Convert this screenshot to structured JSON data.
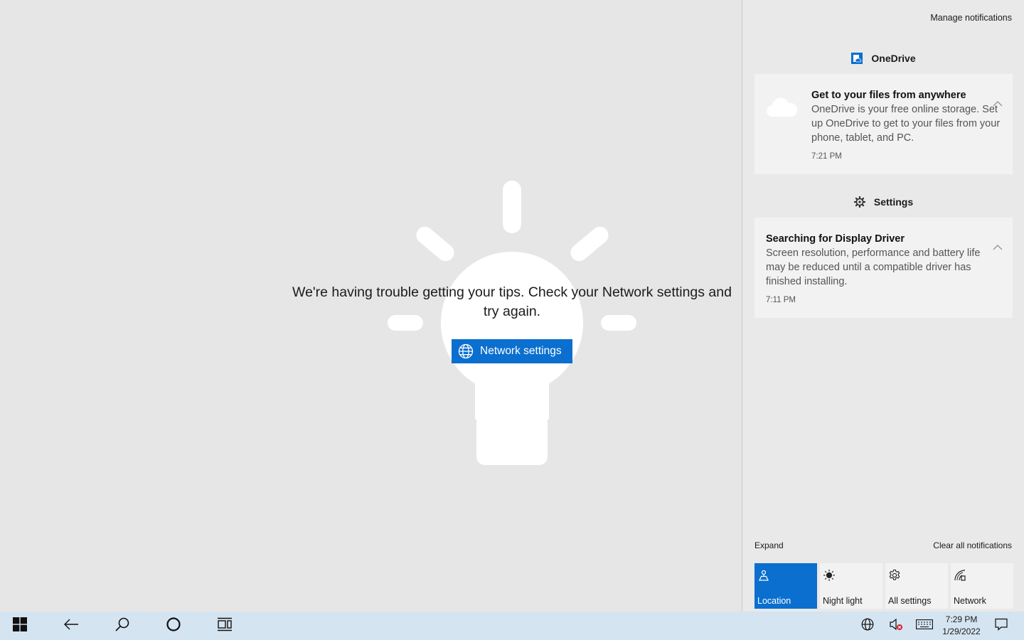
{
  "tips": {
    "message": "We're having trouble getting your tips. Check your Network settings and try again.",
    "button_label": "Network settings",
    "button_icon": "globe-icon"
  },
  "action_center": {
    "manage_label": "Manage notifications",
    "groups": [
      {
        "app": "OneDrive",
        "icon": "onedrive-icon",
        "notification": {
          "title": "Get to your files from anywhere",
          "body": "OneDrive is your free online storage. Set up OneDrive to get to your files from your phone, tablet, and PC.",
          "time": "7:21 PM",
          "icon": "cloud-icon"
        }
      },
      {
        "app": "Settings",
        "icon": "gear-icon",
        "notification": {
          "title": "Searching for Display Driver",
          "body": "Screen resolution, performance and battery life may be reduced until a compatible driver has finished installing.",
          "time": "7:11 PM"
        }
      }
    ],
    "expand_label": "Expand",
    "clear_label": "Clear all notifications",
    "quick_actions": [
      {
        "label": "Location",
        "icon": "location-icon",
        "active": true
      },
      {
        "label": "Night light",
        "icon": "brightness-icon",
        "active": false
      },
      {
        "label": "All settings",
        "icon": "gear-icon",
        "active": false
      },
      {
        "label": "Network",
        "icon": "network-icon",
        "active": false
      }
    ],
    "accent_color": "#0a6fcf"
  },
  "taskbar": {
    "time": "7:29 PM",
    "date": "1/29/2022",
    "buttons": [
      "start-icon",
      "back-icon",
      "search-icon",
      "cortana-icon",
      "task-view-icon"
    ],
    "tray": [
      "globe-icon",
      "volume-muted-icon",
      "keyboard-icon",
      "action-center-icon"
    ],
    "background": "#d4e4f1"
  }
}
